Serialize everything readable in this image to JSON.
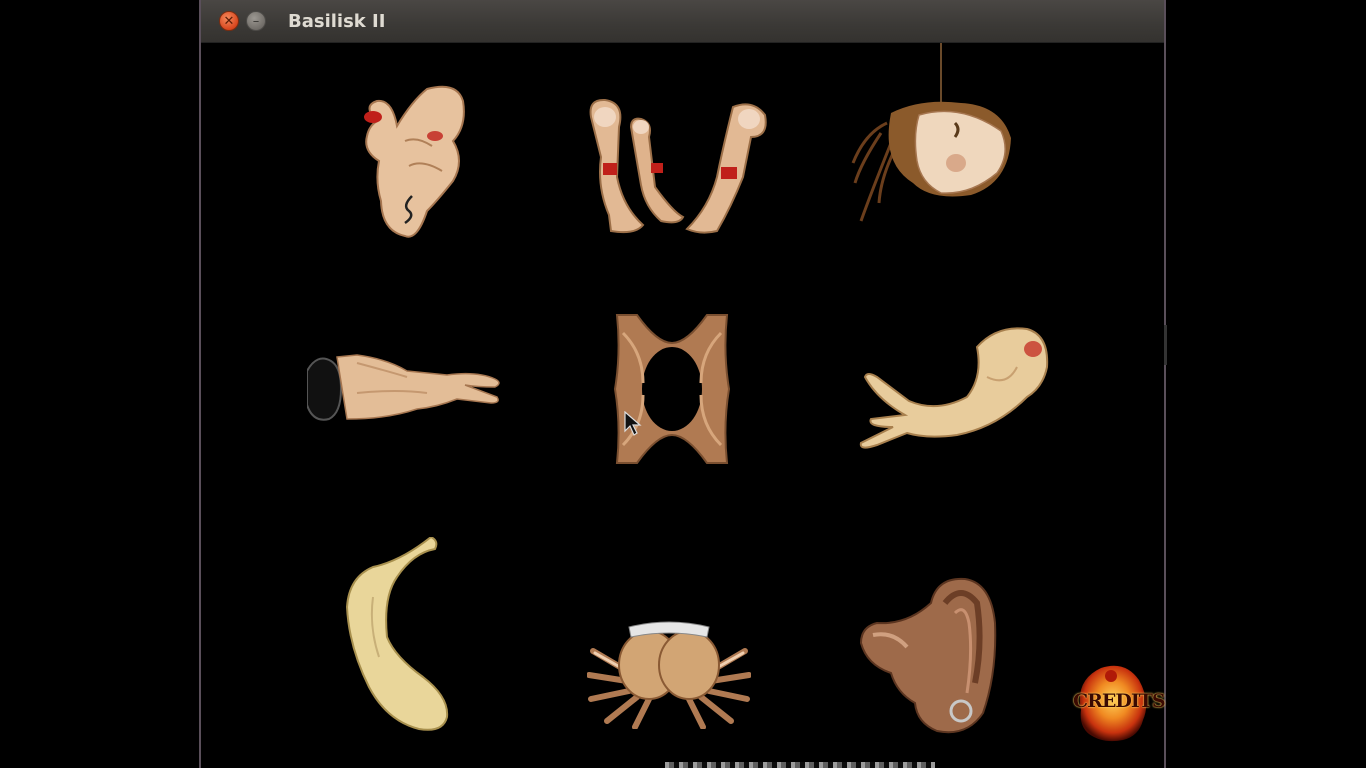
{
  "window": {
    "title": "Basilisk II",
    "close_icon": "close-icon",
    "minimize_icon": "minimize-icon"
  },
  "game": {
    "tiles": [
      {
        "name": "tile-hand-flower",
        "icon": "contorted-hand-figure"
      },
      {
        "name": "tile-three-fingers",
        "icon": "three-fingers-figure"
      },
      {
        "name": "tile-hanging-head",
        "icon": "hanging-head-figure"
      },
      {
        "name": "tile-arm-hand",
        "icon": "arm-reaching-figure"
      },
      {
        "name": "tile-hands-frame",
        "icon": "hands-frame-figure"
      },
      {
        "name": "tile-horn-hands",
        "icon": "horn-hands-figure"
      },
      {
        "name": "tile-bent-limb",
        "icon": "bent-limb-figure"
      },
      {
        "name": "tile-hand-fan",
        "icon": "hand-fan-figure"
      },
      {
        "name": "tile-ear-shape",
        "icon": "ear-shape-figure"
      }
    ],
    "credits_label": "CREDITS"
  },
  "colors": {
    "skin": "#e8c49a",
    "skin_shadow": "#b98a5c",
    "blood": "#c0201a",
    "credits_fire": "#e0471a"
  }
}
